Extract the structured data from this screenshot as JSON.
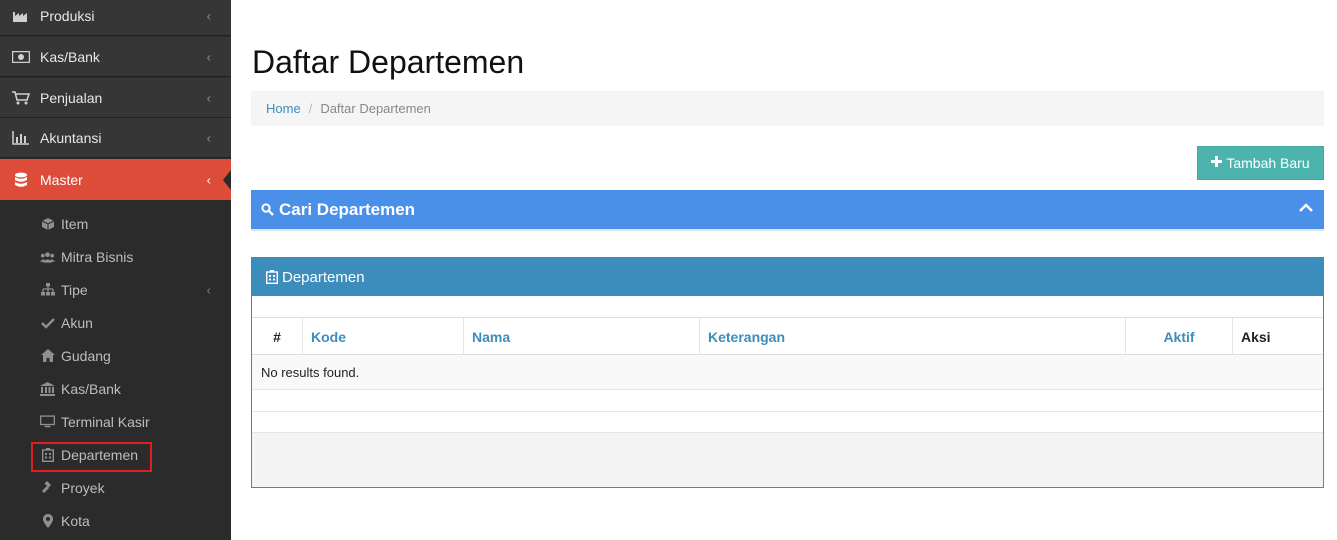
{
  "sidebar": {
    "menu": [
      {
        "label": "Produksi",
        "icon": "factory-icon",
        "chevron": "‹"
      },
      {
        "label": "Kas/Bank",
        "icon": "money-icon",
        "chevron": "‹"
      },
      {
        "label": "Penjualan",
        "icon": "cart-icon",
        "chevron": "‹"
      },
      {
        "label": "Akuntansi",
        "icon": "bar-chart-icon",
        "chevron": "‹"
      },
      {
        "label": "Master",
        "icon": "database-icon",
        "chevron": "‹"
      }
    ],
    "submenu": [
      {
        "label": "Item",
        "icon": "cube-icon"
      },
      {
        "label": "Mitra Bisnis",
        "icon": "users-icon"
      },
      {
        "label": "Tipe",
        "icon": "sitemap-icon",
        "chevron": "‹"
      },
      {
        "label": "Akun",
        "icon": "check-icon"
      },
      {
        "label": "Gudang",
        "icon": "home-icon"
      },
      {
        "label": "Kas/Bank",
        "icon": "bank-icon"
      },
      {
        "label": "Terminal Kasir",
        "icon": "desktop-icon"
      },
      {
        "label": "Departemen",
        "icon": "building-icon"
      },
      {
        "label": "Proyek",
        "icon": "gavel-icon"
      },
      {
        "label": "Kota",
        "icon": "map-marker-icon"
      }
    ],
    "active_menu": "Master",
    "highlighted_submenu": "Departemen"
  },
  "page": {
    "title": "Daftar Departemen",
    "breadcrumb": {
      "home": "Home",
      "separator": "/",
      "current": "Daftar Departemen"
    }
  },
  "toolbar": {
    "add_label": "Tambah Baru",
    "add_icon": "plus-icon"
  },
  "search_panel": {
    "title": "Cari Departemen",
    "icon": "search-icon",
    "toggle_icon": "chevron-up-icon"
  },
  "dept_panel": {
    "title": "Departemen",
    "icon": "building-icon",
    "table": {
      "columns": [
        "#",
        "Kode",
        "Nama",
        "Keterangan",
        "Aktif",
        "Aksi"
      ],
      "empty_text": "No results found."
    }
  },
  "colors": {
    "sidebar_bg": "#2b2b2b",
    "menu_bg": "#363636",
    "active_menu": "#dd4b39",
    "add_button": "#4cb4ac",
    "search_panel": "#4a8fe8",
    "dept_panel": "#3c8dbc",
    "link": "#3c8dbc",
    "highlight_border": "#e01e1e"
  }
}
